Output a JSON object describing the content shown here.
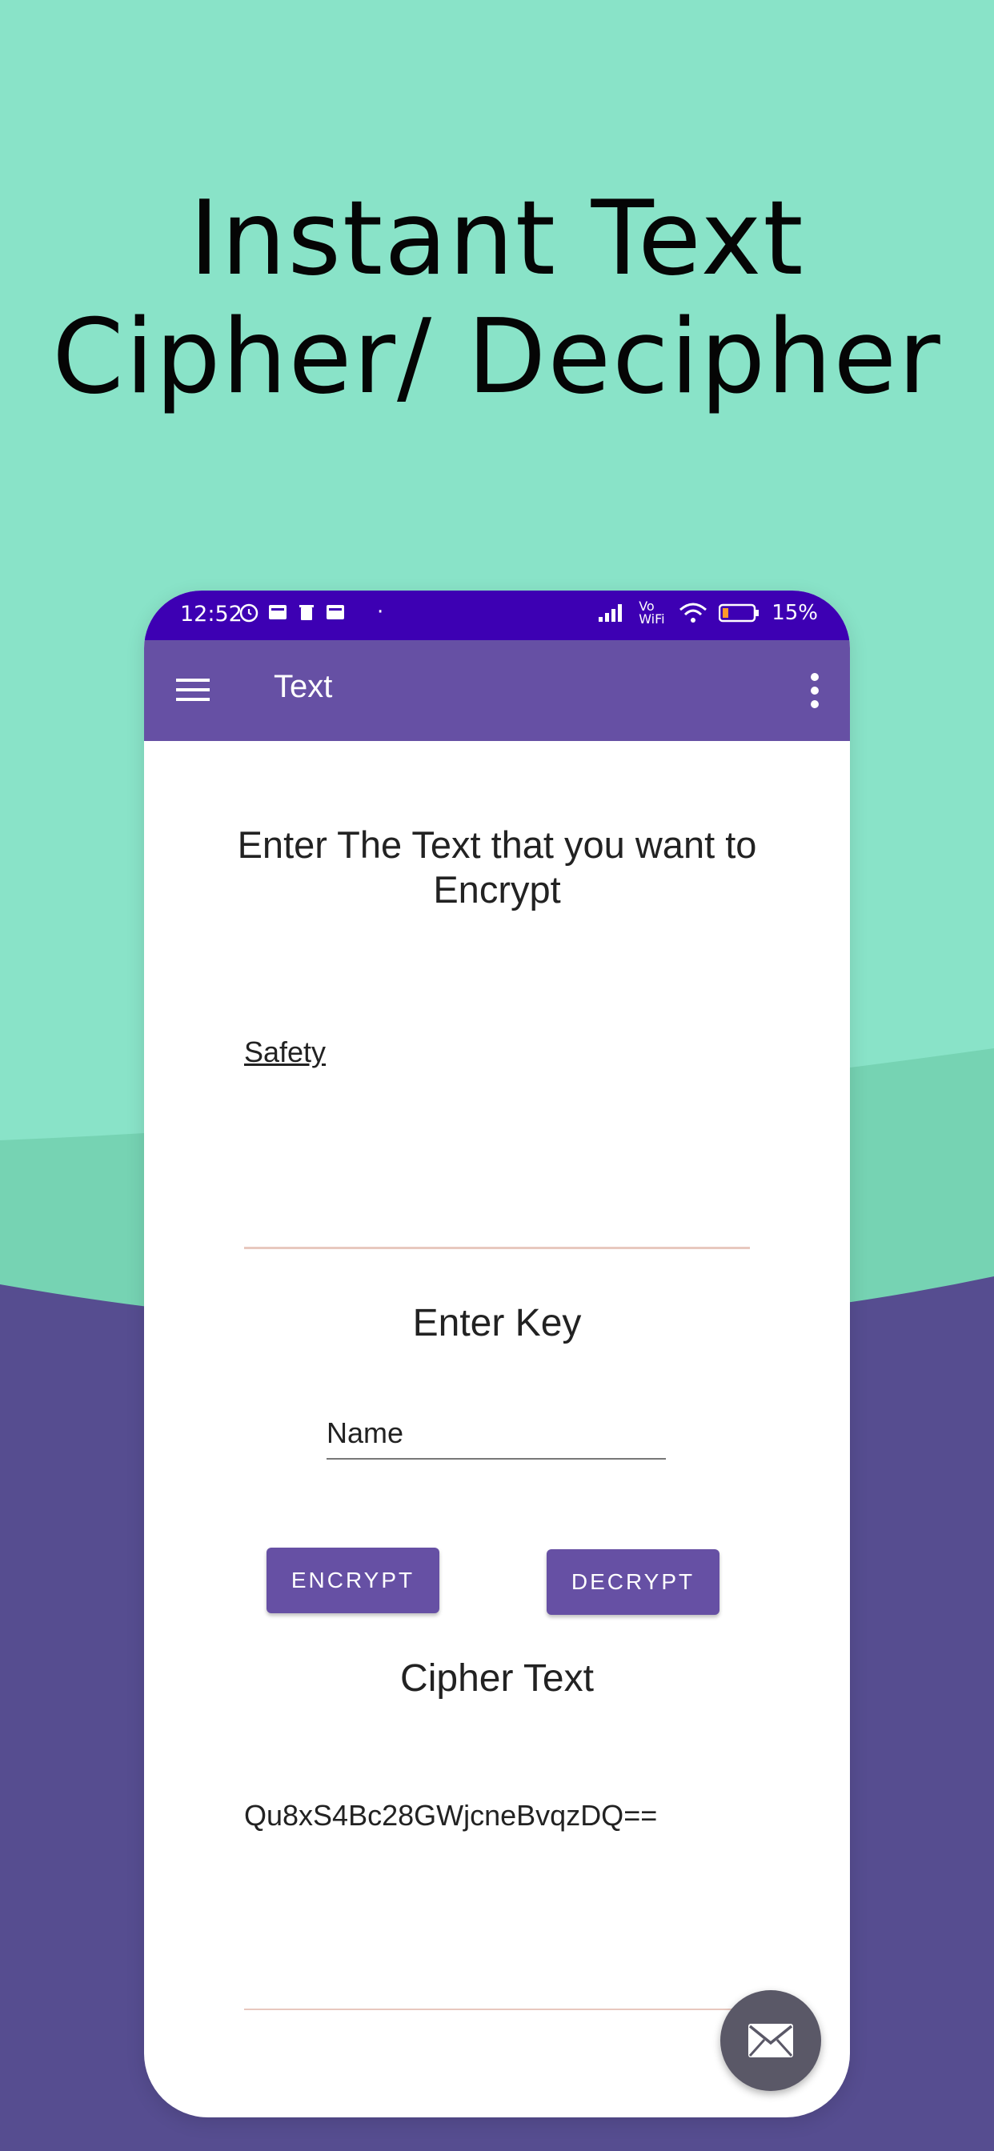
{
  "headline": {
    "line1": "Instant Text",
    "line2": "Cipher/ Decipher"
  },
  "colors": {
    "background_top": "#89e3c8",
    "background_wave": "#76d3b3",
    "background_bottom": "#564d90",
    "status_bar": "#3d00b3",
    "app_bar": "#6650a4",
    "fab": "#5a5867"
  },
  "status_bar": {
    "time": "12:52",
    "battery": "15%",
    "network_label": "Vo WiFi"
  },
  "app_bar": {
    "title": "Text"
  },
  "main": {
    "prompt": "Enter The Text that you want to Encrypt",
    "text_value": "Safety",
    "key_label": "Enter Key",
    "key_value": "Name",
    "encrypt_label": "ENCRYPT",
    "decrypt_label": "DECRYPT",
    "cipher_label": "Cipher Text",
    "cipher_value": "Qu8xS4Bc28GWjcneBvqzDQ=="
  },
  "icons": {
    "menu": "hamburger-menu-icon",
    "overflow": "more-vert-icon",
    "fab": "email-icon"
  }
}
